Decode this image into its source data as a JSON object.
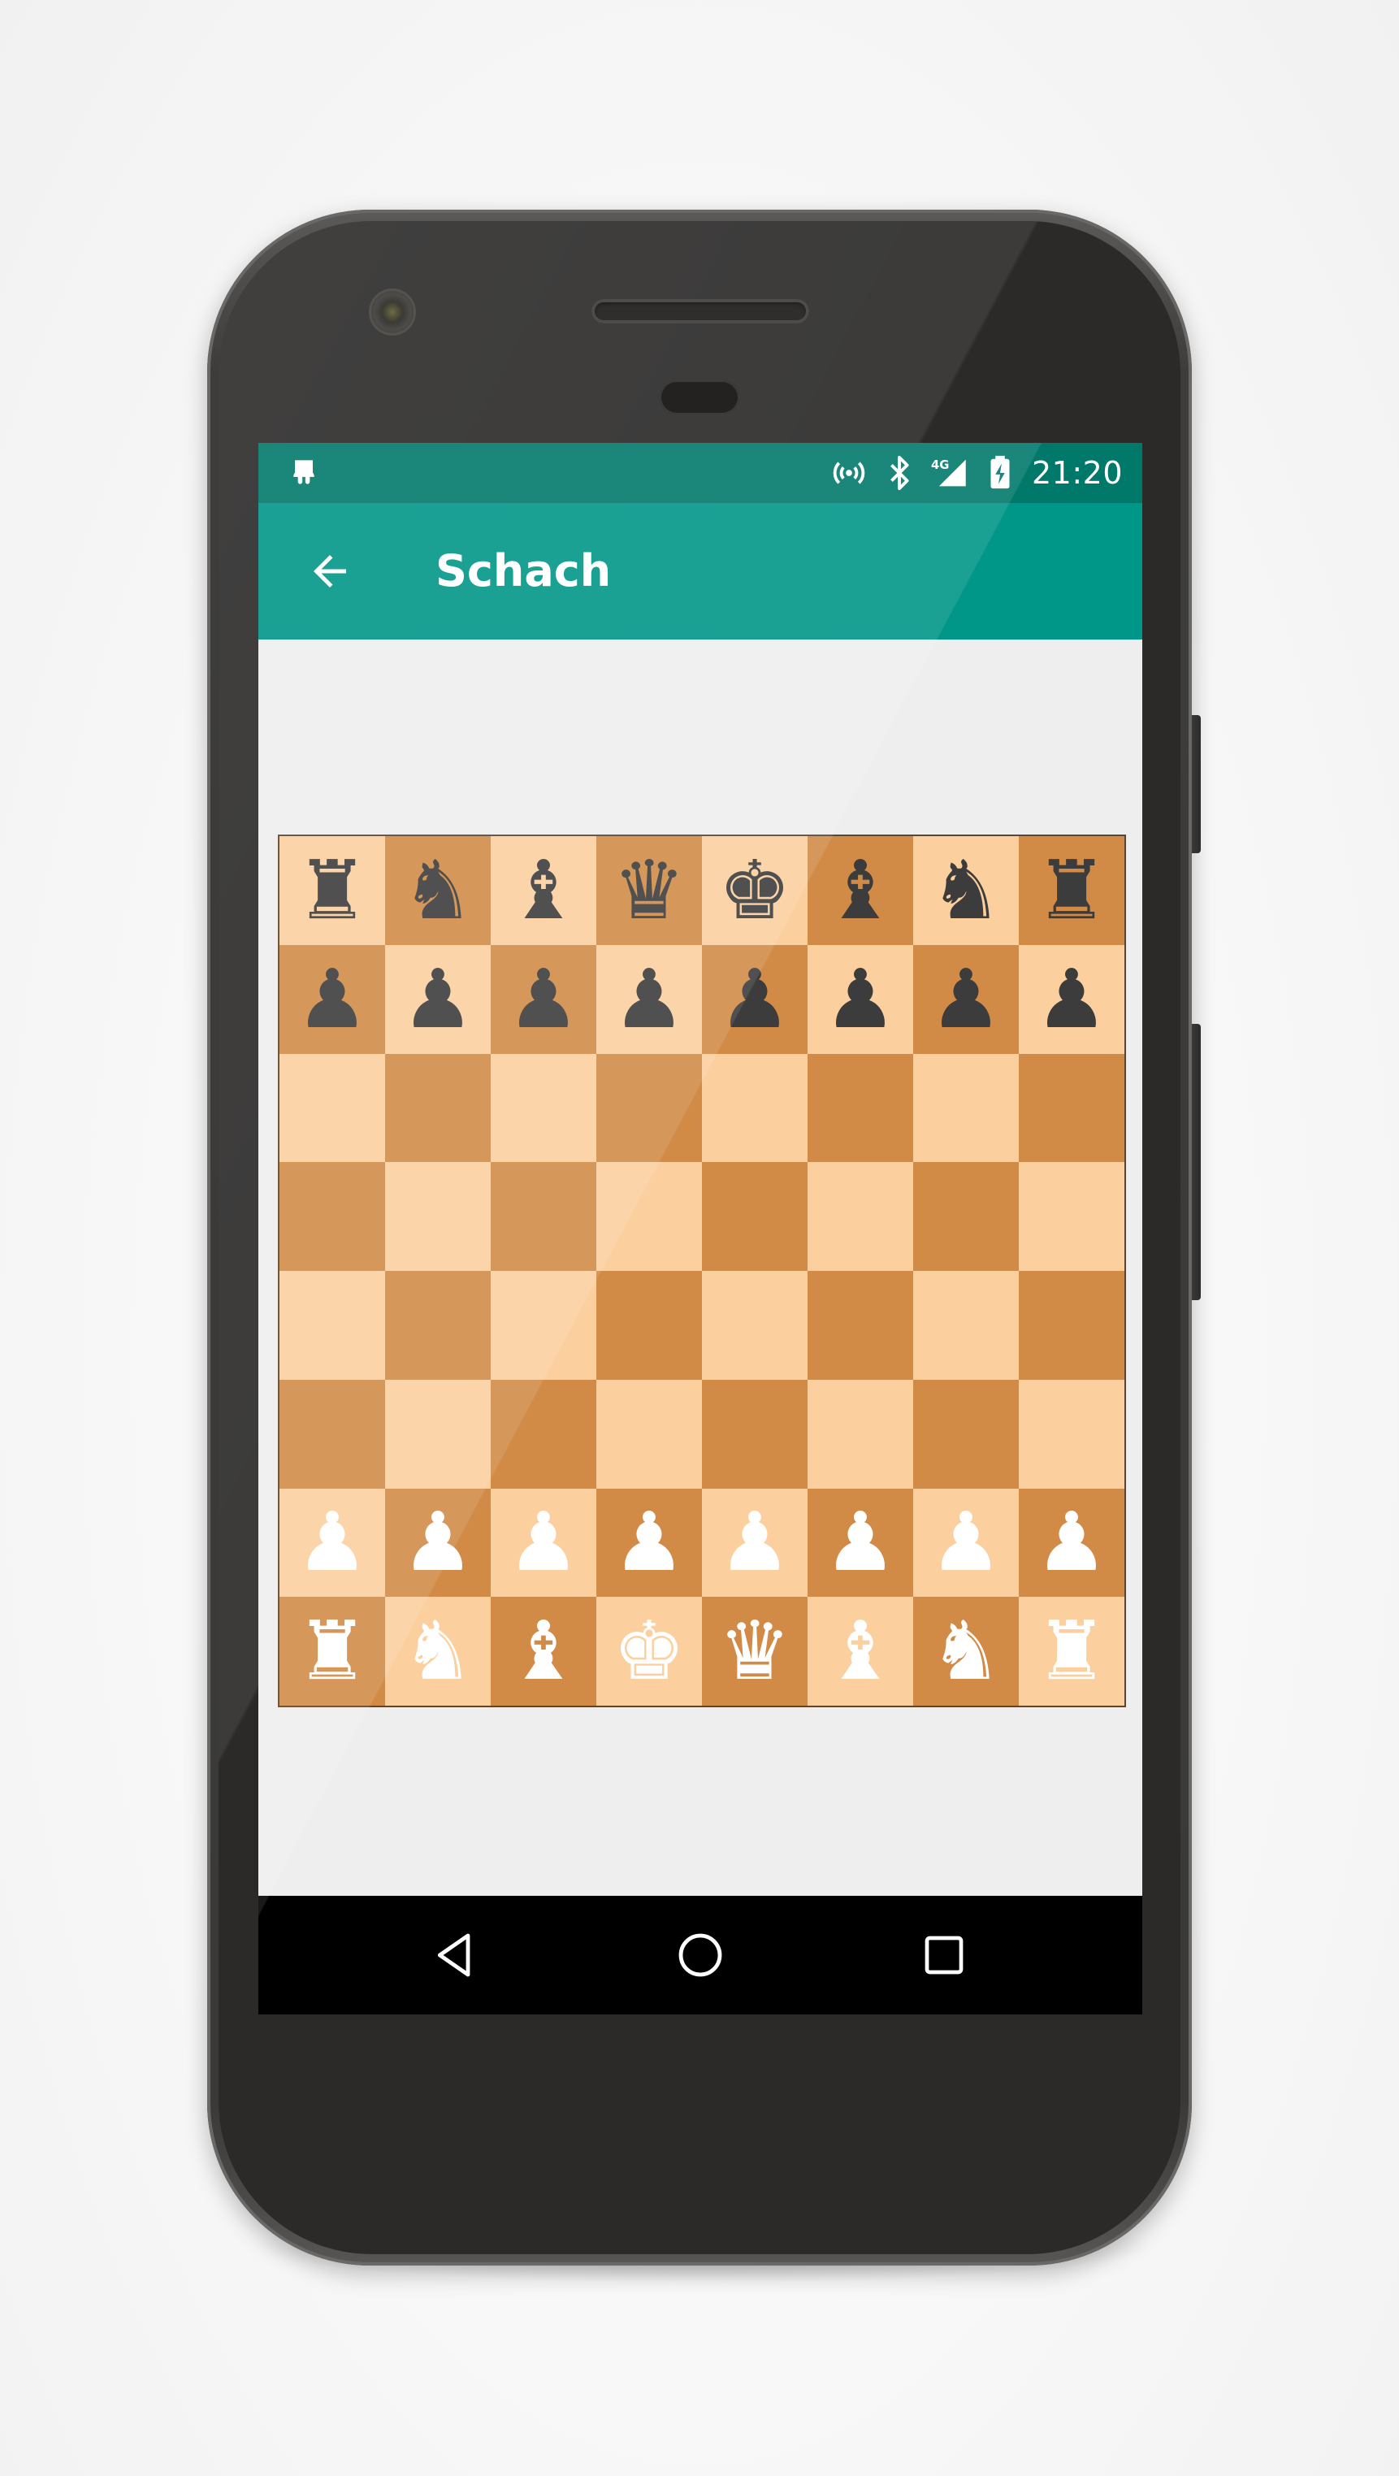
{
  "status_bar": {
    "time": "21:20",
    "left_icon": "android-debug-icon",
    "icons": [
      "hotspot-icon",
      "bluetooth-icon",
      "signal-4g-icon",
      "battery-charging-icon"
    ],
    "network_label": "4G",
    "color": "#00796b"
  },
  "app_bar": {
    "title": "Schach",
    "back_icon": "arrow-back-icon",
    "color": "#009688"
  },
  "board": {
    "light_color": "#fccf9f",
    "dark_color": "#d18b47",
    "black_piece_color": "#3c3c3c",
    "white_piece_color": "#ffffff",
    "rows": [
      [
        "black-rook",
        "black-knight",
        "black-bishop",
        "black-queen",
        "black-king",
        "black-bishop",
        "black-knight",
        "black-rook"
      ],
      [
        "black-pawn",
        "black-pawn",
        "black-pawn",
        "black-pawn",
        "black-pawn",
        "black-pawn",
        "black-pawn",
        "black-pawn"
      ],
      [
        "",
        "",
        "",
        "",
        "",
        "",
        "",
        ""
      ],
      [
        "",
        "",
        "",
        "",
        "",
        "",
        "",
        ""
      ],
      [
        "",
        "",
        "",
        "",
        "",
        "",
        "",
        ""
      ],
      [
        "",
        "",
        "",
        "",
        "",
        "",
        "",
        ""
      ],
      [
        "white-pawn",
        "white-pawn",
        "white-pawn",
        "white-pawn",
        "white-pawn",
        "white-pawn",
        "white-pawn",
        "white-pawn"
      ],
      [
        "white-rook",
        "white-knight",
        "white-bishop",
        "white-king",
        "white-queen",
        "white-bishop",
        "white-knight",
        "white-rook"
      ]
    ]
  },
  "nav_bar": {
    "buttons": [
      "back-triangle-icon",
      "home-circle-icon",
      "recents-square-icon"
    ]
  }
}
